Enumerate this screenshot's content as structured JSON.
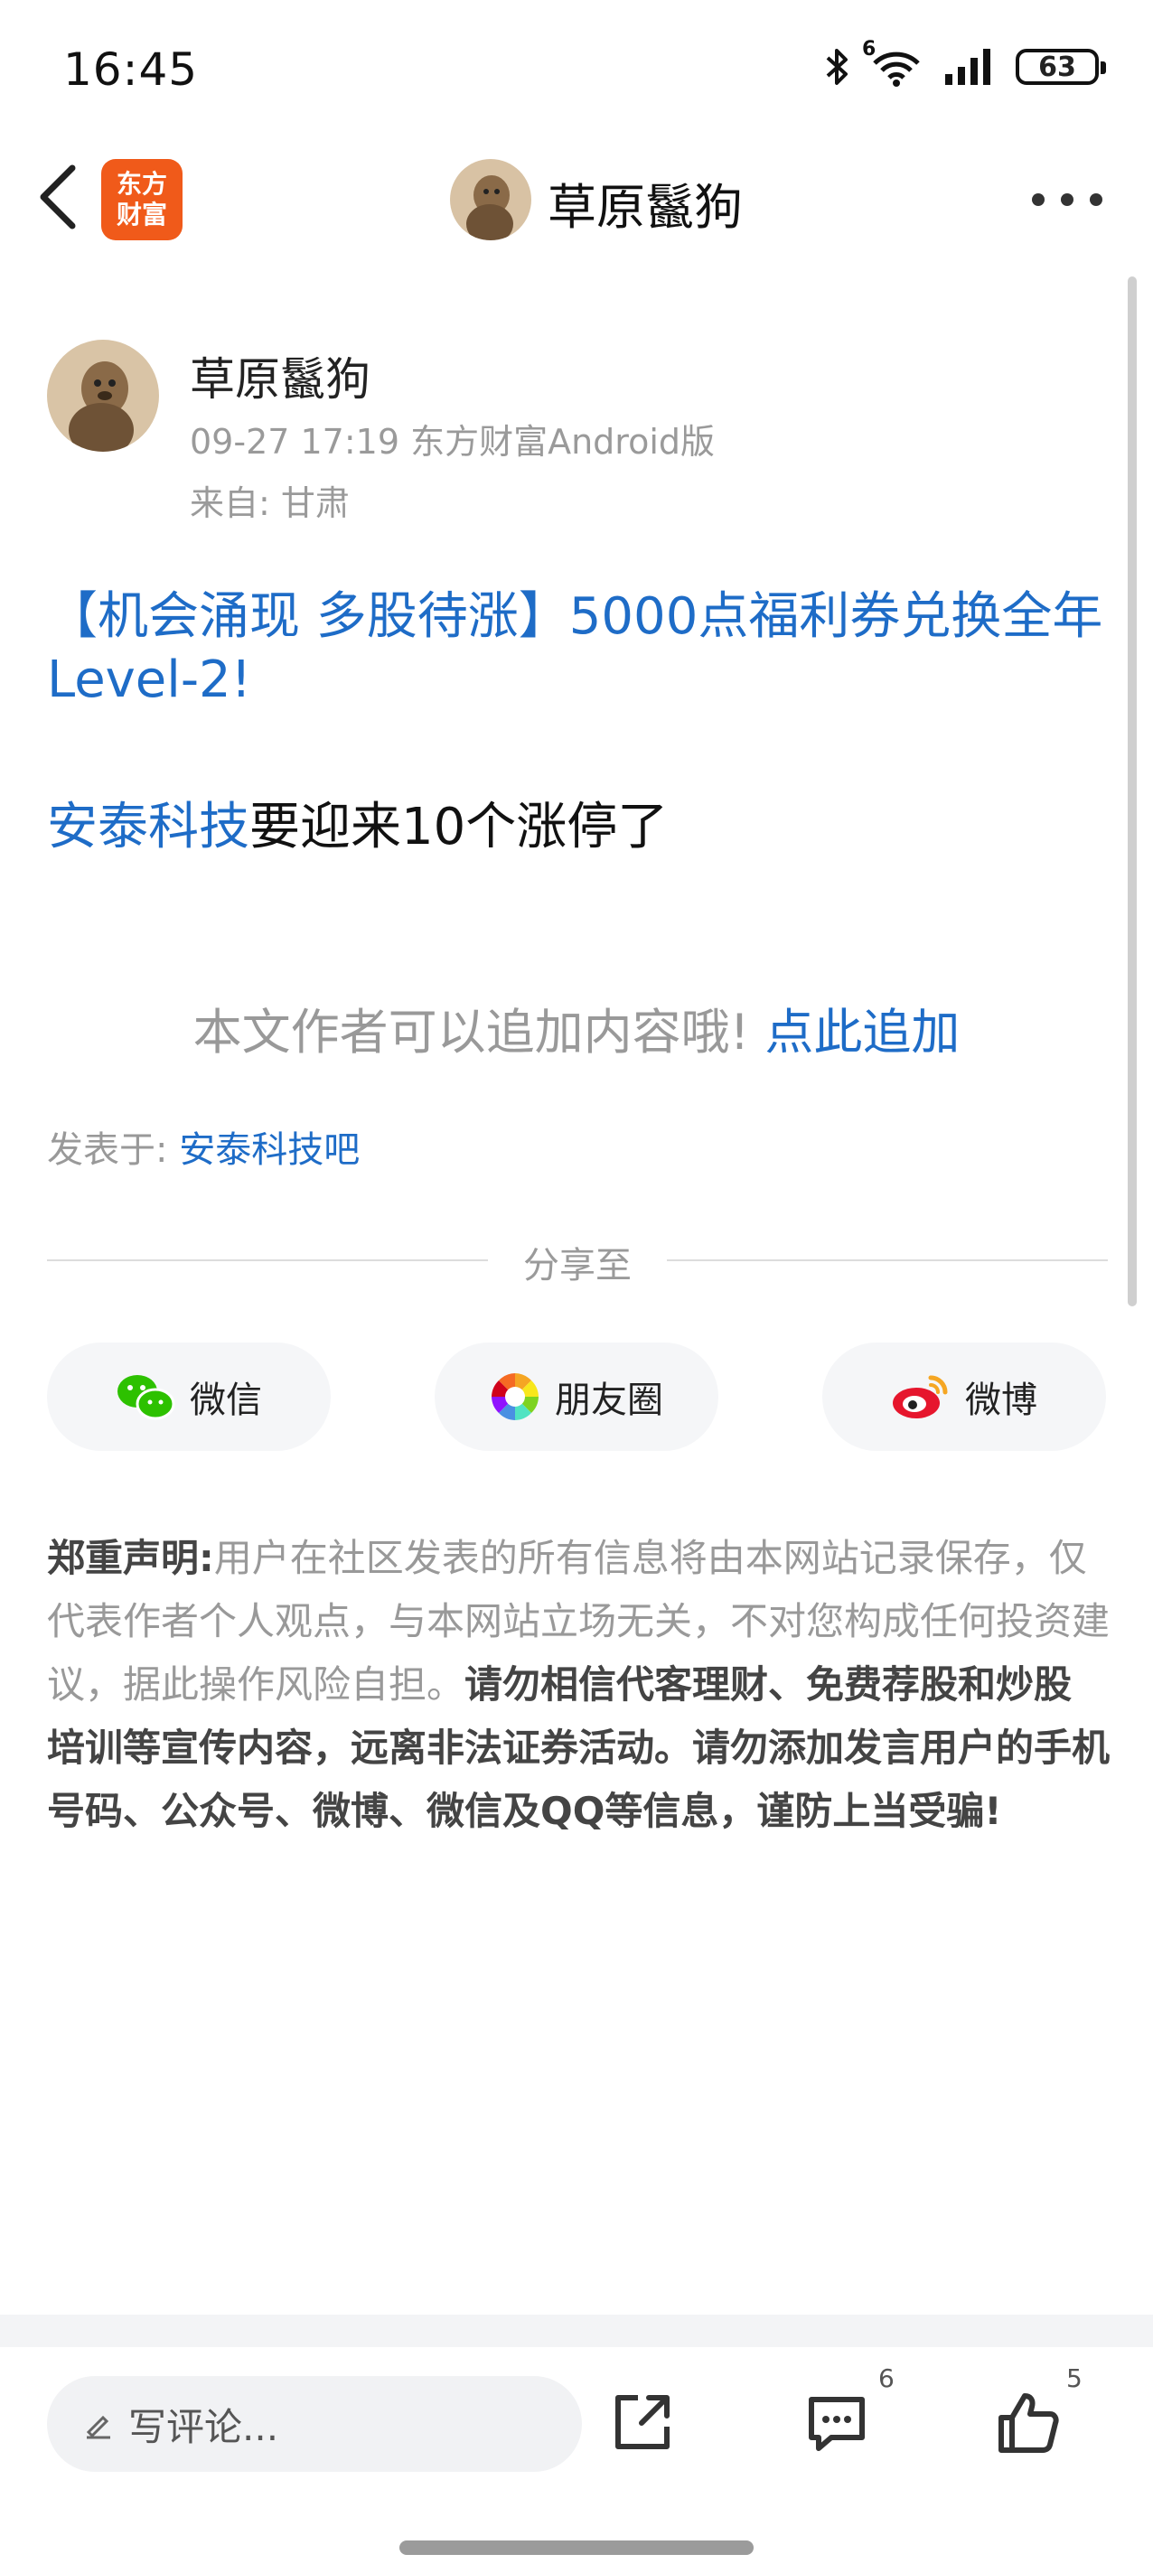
{
  "status_bar": {
    "time": "16:45",
    "battery": "63",
    "network": "6"
  },
  "header": {
    "app_logo_line1": "东方",
    "app_logo_line2": "财富",
    "title": "草原鬣狗"
  },
  "post": {
    "author": "草原鬣狗",
    "meta": "09-27 17:19 东方财富Android版",
    "location": "来自: 甘肃",
    "promo": "【机会涌现 多股待涨】5000点福利券兑换全年Level-2!",
    "stock_link": "安泰科技",
    "body_text": "要迎来10个涨停了",
    "append_hint": "本文作者可以追加内容哦!",
    "append_link": "点此追加",
    "posted_in_label": "发表于: ",
    "posted_in_link": "安泰科技吧"
  },
  "share": {
    "label": "分享至",
    "wechat": "微信",
    "moments": "朋友圈",
    "weibo": "微博"
  },
  "disclaimer": {
    "title": "郑重声明:",
    "text": "用户在社区发表的所有信息将由本网站记录保存，仅代表作者个人观点，与本网站立场无关，不对您构成任何投资建议，据此操作风险自担。",
    "bold": "请勿相信代客理财、免费荐股和炒股培训等宣传内容，远离非法证券活动。请勿添加发言用户的手机号码、公众号、微博、微信及QQ等信息，谨防上当受骗!"
  },
  "bottom_bar": {
    "comment_placeholder": "写评论...",
    "comment_count": "6",
    "like_count": "5"
  },
  "colors": {
    "link": "#1e6cc7",
    "logo": "#f05a1a",
    "muted": "#999999"
  }
}
